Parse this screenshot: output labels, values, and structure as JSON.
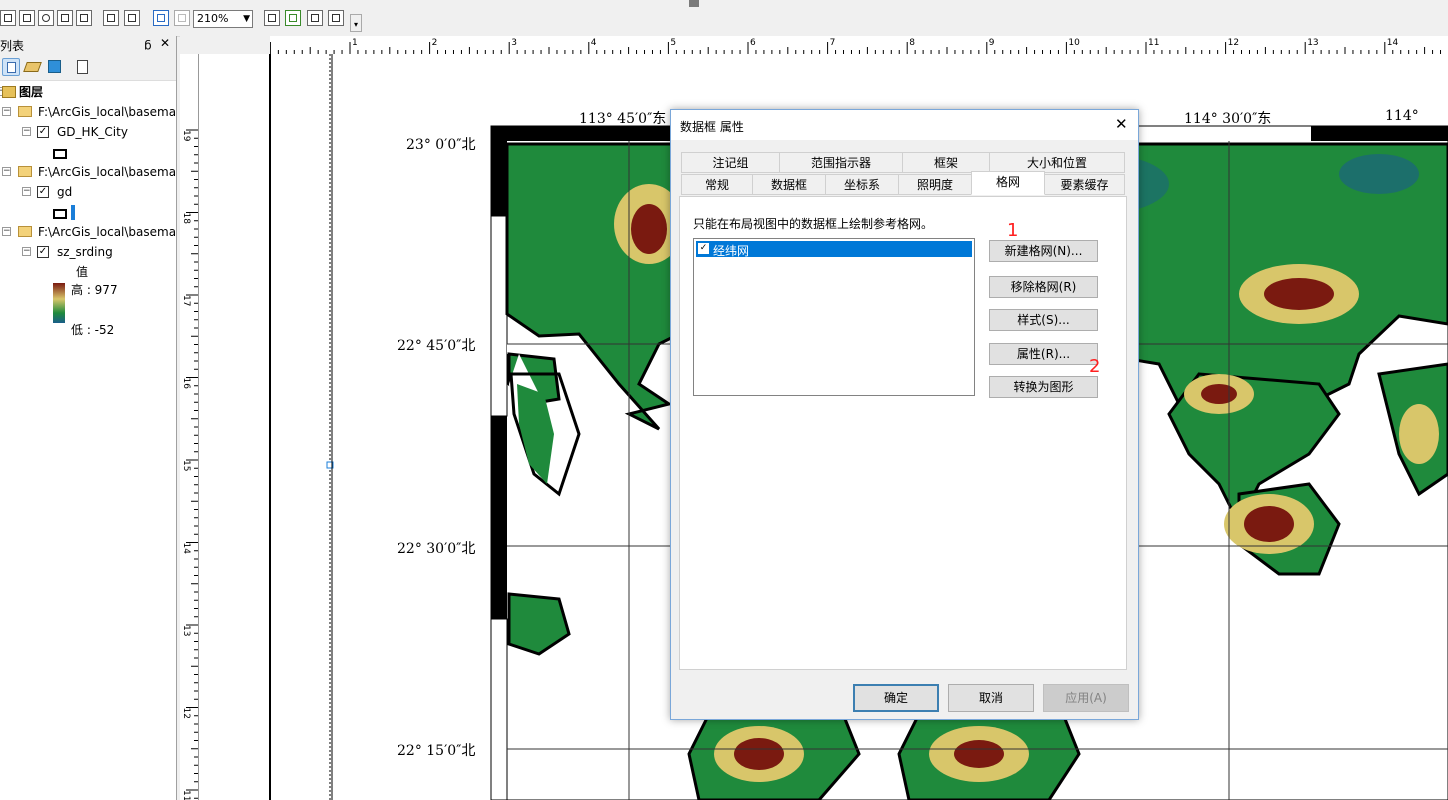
{
  "toolbar": {
    "zoom_value": "210%"
  },
  "toc": {
    "title": "内容列表",
    "pin_icon": "pin-icon",
    "close_symbol": "✕",
    "layers_root": "图层",
    "groups": [
      {
        "path": "F:\\ArcGis_local\\basema",
        "layer": "GD_HK_City"
      },
      {
        "path": "F:\\ArcGis_local\\basema",
        "layer": "gd"
      },
      {
        "path": "F:\\ArcGis_local\\basema",
        "layer": "sz_srding"
      }
    ],
    "legend": {
      "field": "值",
      "high": "高 : 977",
      "low": "低 : -52"
    }
  },
  "hruler": [
    "1",
    "2",
    "3",
    "4",
    "5",
    "6",
    "7",
    "8",
    "9",
    "10",
    "11",
    "12",
    "13",
    "14"
  ],
  "vruler": [
    "19",
    "18",
    "17",
    "16",
    "15",
    "14",
    "13",
    "12",
    "11"
  ],
  "map": {
    "top_labels": [
      "113° 45′0″东",
      "114° 30′0″东",
      "114° "
    ],
    "left_labels": [
      "23° 0′0″北",
      "22° 45′0″北",
      "22° 30′0″北",
      "22° 15′0″北"
    ],
    "colors": {
      "sea": "#ffffff",
      "green": "#1f8a3c",
      "dark": "#1a5e8a",
      "yellow": "#d8c66a",
      "brown": "#7a1a10"
    }
  },
  "dialog": {
    "title": "数据框 属性",
    "close_symbol": "✕",
    "tabs_row1": [
      "注记组",
      "范围指示器",
      "框架",
      "大小和位置"
    ],
    "tabs_row2": [
      "常规",
      "数据框",
      "坐标系",
      "照明度",
      "格网",
      "要素缓存"
    ],
    "active_tab": "格网",
    "instruction": "只能在布局视图中的数据框上绘制参考格网。",
    "grid_items": [
      "经纬网"
    ],
    "side_buttons": [
      "新建格网(N)...",
      "移除格网(R)",
      "样式(S)...",
      "属性(R)...",
      "转换为图形"
    ],
    "annotations": [
      "1",
      "2"
    ],
    "ok": "确定",
    "cancel": "取消",
    "apply": "应用(A)"
  }
}
